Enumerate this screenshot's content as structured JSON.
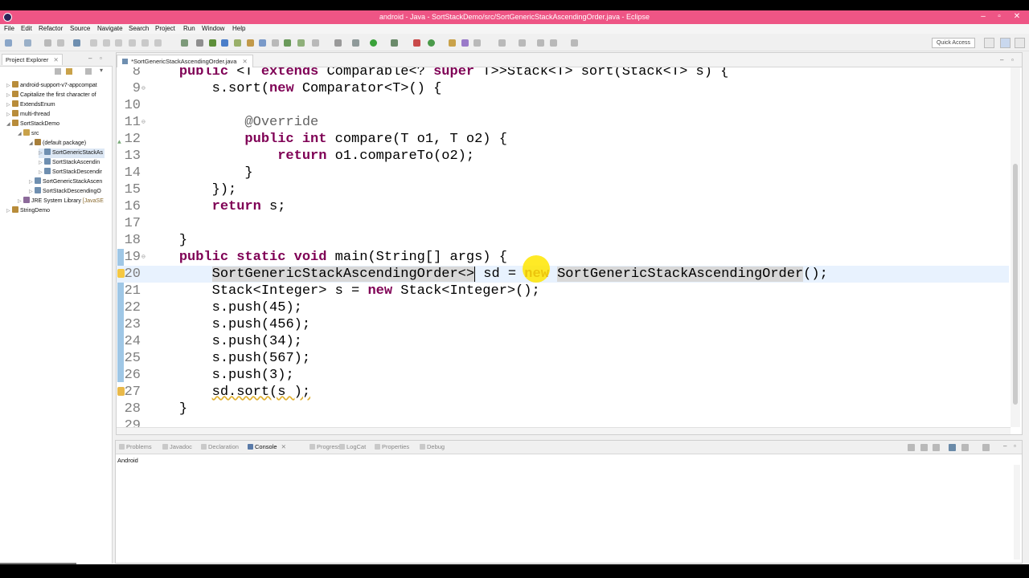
{
  "window": {
    "title": "android - Java - SortStackDemo/src/SortGenericStackAscendingOrder.java - Eclipse",
    "minimize": "–",
    "maximize": "▫",
    "close": "✕"
  },
  "menu": [
    "File",
    "Edit",
    "Refactor",
    "Source",
    "Navigate",
    "Search",
    "Project",
    "Run",
    "Window",
    "Help"
  ],
  "toolbar": {
    "quick_access": "Quick Access"
  },
  "explorer": {
    "tab_label": "Project Explorer",
    "tab_close": "✕",
    "items": [
      {
        "label": "android-support-v7-appcompat",
        "suffix": ""
      },
      {
        "label": "Capitalize the first character of",
        "suffix": ""
      },
      {
        "label": "ExtendsEnum",
        "suffix": ""
      },
      {
        "label": "multi-thread",
        "suffix": ""
      },
      {
        "label": "SortStackDemo",
        "suffix": ""
      },
      {
        "label": "src",
        "suffix": ""
      },
      {
        "label": "(default package)",
        "suffix": ""
      },
      {
        "label": "SortGenericStackAs",
        "suffix": ""
      },
      {
        "label": "SortStackAscendin",
        "suffix": ""
      },
      {
        "label": "SortStackDescendir",
        "suffix": ""
      },
      {
        "label": "SortGenericStackAscen",
        "suffix": ""
      },
      {
        "label": "SortStackDescendingO",
        "suffix": ""
      },
      {
        "label": "JRE System Library",
        "suffix": "[JavaSE"
      },
      {
        "label": "StringDemo",
        "suffix": ""
      }
    ]
  },
  "editor": {
    "tab_label": "*SortGenericStackAscendingOrder.java",
    "tab_close": "✕",
    "lines": [
      {
        "n": "8",
        "fold": "",
        "current": false
      },
      {
        "n": "9",
        "fold": "⊖",
        "current": false
      },
      {
        "n": "10",
        "fold": "",
        "current": false
      },
      {
        "n": "11",
        "fold": "⊖",
        "current": false
      },
      {
        "n": "12",
        "fold": "",
        "current": false
      },
      {
        "n": "13",
        "fold": "",
        "current": false
      },
      {
        "n": "14",
        "fold": "",
        "current": false
      },
      {
        "n": "15",
        "fold": "",
        "current": false
      },
      {
        "n": "16",
        "fold": "",
        "current": false
      },
      {
        "n": "17",
        "fold": "",
        "current": false
      },
      {
        "n": "18",
        "fold": "",
        "current": false
      },
      {
        "n": "19",
        "fold": "⊖",
        "current": false
      },
      {
        "n": "20",
        "fold": "",
        "current": true
      },
      {
        "n": "21",
        "fold": "",
        "current": false
      },
      {
        "n": "22",
        "fold": "",
        "current": false
      },
      {
        "n": "23",
        "fold": "",
        "current": false
      },
      {
        "n": "24",
        "fold": "",
        "current": false
      },
      {
        "n": "25",
        "fold": "",
        "current": false
      },
      {
        "n": "26",
        "fold": "",
        "current": false
      },
      {
        "n": "27",
        "fold": "",
        "current": false
      },
      {
        "n": "28",
        "fold": "",
        "current": false
      },
      {
        "n": "29",
        "fold": "",
        "current": false
      }
    ],
    "code": {
      "l8": {
        "indent": "    ",
        "kw1": "public",
        "t1": " <T ",
        "kw2": "extends",
        "t2": " Comparable<? ",
        "kw3": "super",
        "t3": " T>>Stack<T> sort(Stack<T> s) {"
      },
      "l9": {
        "indent": "        ",
        "t1": "s.sort(",
        "kw1": "new",
        "t2": " Comparator<T>() {"
      },
      "l11": {
        "indent": "            ",
        "ann": "@Override"
      },
      "l12": {
        "indent": "            ",
        "kw1": "public",
        "t1": " ",
        "kw2": "int",
        "t2": " compare(T o1, T o2) {"
      },
      "l13": {
        "indent": "                ",
        "kw1": "return",
        "t1": " o1.compareTo(o2);"
      },
      "l14": {
        "indent": "            ",
        "t1": "}"
      },
      "l15": {
        "indent": "        ",
        "t1": "});"
      },
      "l16": {
        "indent": "        ",
        "kw1": "return",
        "t1": " s;"
      },
      "l18": {
        "indent": "    ",
        "t1": "}"
      },
      "l19": {
        "indent": "    ",
        "kw1": "public",
        "t1": " ",
        "kw2": "static",
        "t2": " ",
        "kw3": "void",
        "t3": " main(String[] args) {"
      },
      "l20": {
        "indent": "        ",
        "hl1": "SortGenericStackAscendingOrder<>",
        "t1": " sd = ",
        "kw1": "new",
        "t2": " ",
        "hl2": "SortGenericStackAscendingOrder",
        "t3": "();"
      },
      "l21": {
        "indent": "        ",
        "t1": "Stack<Integer> s = ",
        "kw1": "new",
        "t2": " Stack<Integer>();"
      },
      "l22": {
        "indent": "        ",
        "t1": "s.push(45);"
      },
      "l23": {
        "indent": "        ",
        "t1": "s.push(456);"
      },
      "l24": {
        "indent": "        ",
        "t1": "s.push(34);"
      },
      "l25": {
        "indent": "        ",
        "t1": "s.push(567);"
      },
      "l26": {
        "indent": "        ",
        "t1": "s.push(3);"
      },
      "l27": {
        "indent": "        ",
        "t1": "sd.sort(s );"
      },
      "l28": {
        "indent": "    ",
        "t1": "}"
      }
    }
  },
  "bottom_panel": {
    "tabs": [
      "Problems",
      "Javadoc",
      "Declaration",
      "Console",
      "Progress",
      "LogCat",
      "Properties",
      "Debug"
    ],
    "active_tab": "Console",
    "console_close": "✕",
    "console_label": "Android"
  },
  "colors": {
    "titlebar": "#ee5585",
    "keyword": "#7f0055",
    "annotation": "#646464",
    "current_line": "#e8f2fe",
    "highlight_spot": "#ffe600"
  }
}
